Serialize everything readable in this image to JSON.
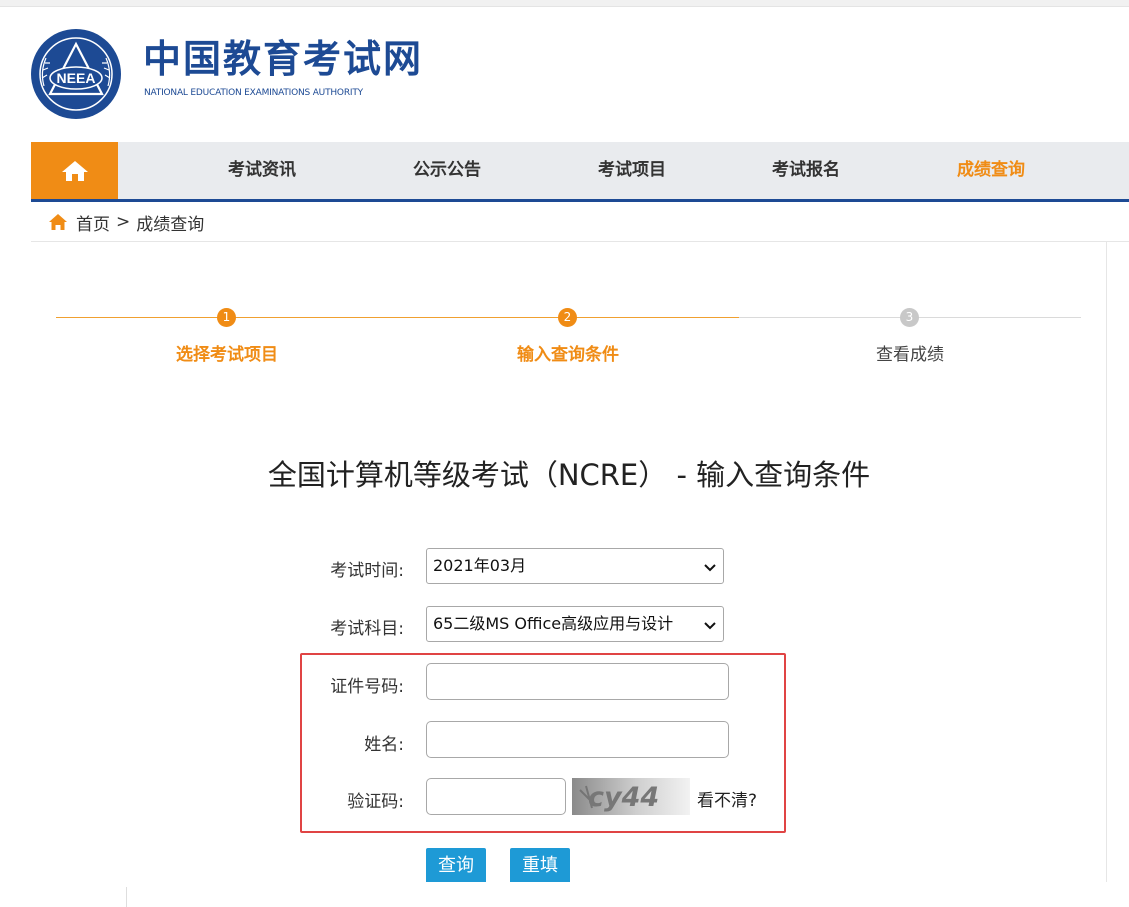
{
  "header": {
    "site_title": "中国教育考试网",
    "site_subtitle": "NATIONAL EDUCATION EXAMINATIONS AUTHORITY",
    "emblem_text": "NEEA",
    "brand_color": "#1d4a94",
    "accent_color": "#f08c15"
  },
  "nav": {
    "home_icon": "home-icon",
    "items": [
      {
        "label": "考试资讯"
      },
      {
        "label": "公示公告"
      },
      {
        "label": "考试项目"
      },
      {
        "label": "考试报名"
      },
      {
        "label": "成绩查询",
        "active": true
      }
    ]
  },
  "breadcrumb": {
    "home": "首页",
    "separator": ">",
    "current": "成绩查询"
  },
  "steps": [
    {
      "num": "1",
      "label": "选择考试项目",
      "state": "done"
    },
    {
      "num": "2",
      "label": "输入查询条件",
      "state": "current"
    },
    {
      "num": "3",
      "label": "查看成绩",
      "state": "todo"
    }
  ],
  "page_title": "全国计算机等级考试（NCRE） - 输入查询条件",
  "form": {
    "exam_time": {
      "label": "考试时间:",
      "value": "2021年03月"
    },
    "exam_subject": {
      "label": "考试科目:",
      "value": "65二级MS Office高级应用与设计"
    },
    "id_number": {
      "label": "证件号码:",
      "value": ""
    },
    "name": {
      "label": "姓名:",
      "value": ""
    },
    "captcha": {
      "label": "验证码:",
      "value": "",
      "image_text": "cy44",
      "refresh_label": "看不清?"
    },
    "submit_label": "查询",
    "reset_label": "重填"
  },
  "colors": {
    "button": "#1e9ad6",
    "highlight_border": "#e04444"
  }
}
